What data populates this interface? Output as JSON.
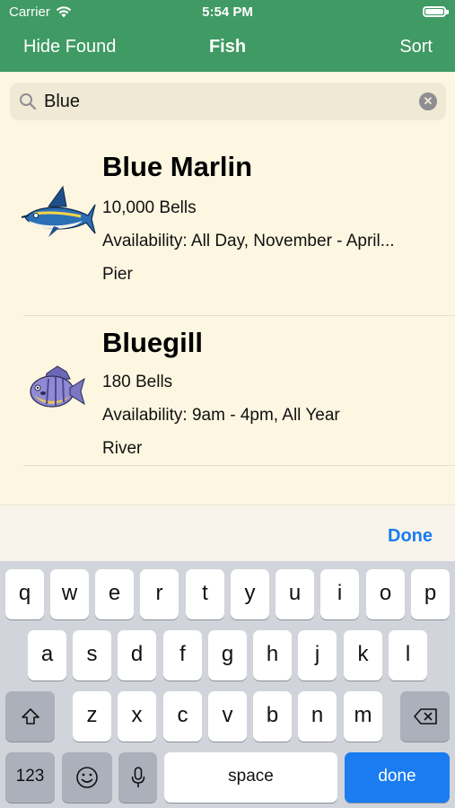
{
  "status": {
    "carrier": "Carrier",
    "time": "5:54 PM"
  },
  "nav": {
    "left": "Hide Found",
    "title": "Fish",
    "right": "Sort"
  },
  "search": {
    "value": "Blue"
  },
  "results": [
    {
      "name": "Blue Marlin",
      "price": "10,000 Bells",
      "availability": "Availability: All Day, November - April...",
      "location": "Pier"
    },
    {
      "name": "Bluegill",
      "price": "180 Bells",
      "availability": "Availability: 9am - 4pm, All Year",
      "location": "River"
    }
  ],
  "accessory": {
    "done": "Done"
  },
  "keyboard": {
    "row1": [
      "q",
      "w",
      "e",
      "r",
      "t",
      "y",
      "u",
      "i",
      "o",
      "p"
    ],
    "row2": [
      "a",
      "s",
      "d",
      "f",
      "g",
      "h",
      "j",
      "k",
      "l"
    ],
    "row3": [
      "z",
      "x",
      "c",
      "v",
      "b",
      "n",
      "m"
    ],
    "numbers": "123",
    "space": "space",
    "return": "done"
  },
  "colors": {
    "nav": "#3f9a63",
    "background": "#fdf6e1",
    "accent": "#1a7cf0"
  }
}
